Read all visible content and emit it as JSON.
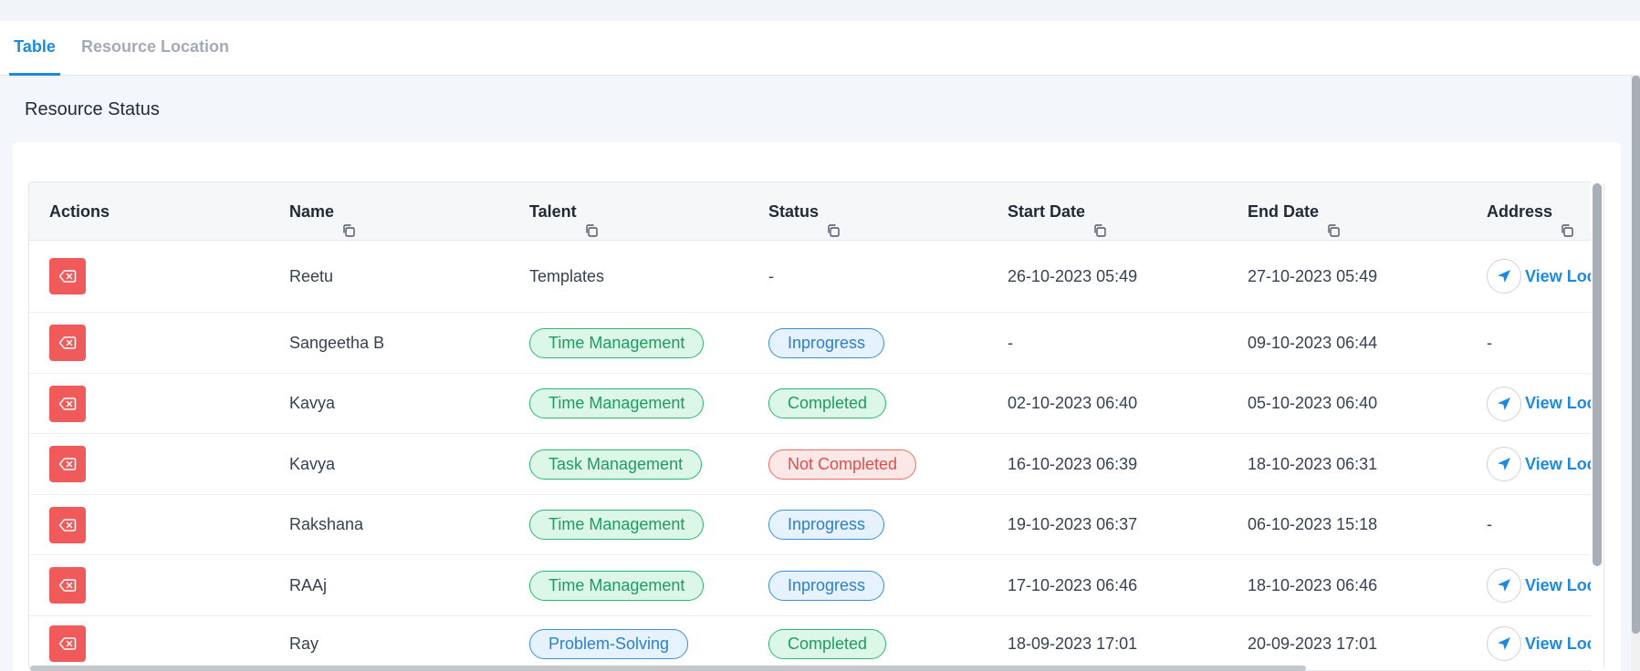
{
  "tabs": [
    {
      "label": "Table",
      "active": true
    },
    {
      "label": "Resource Location",
      "active": false
    }
  ],
  "page_title": "Resource Status",
  "table": {
    "columns": [
      "Actions",
      "Name",
      "Talent",
      "Status",
      "Start Date",
      "End Date",
      "Address"
    ],
    "view_location_label": "View Loc",
    "rows": [
      {
        "name": "Reetu",
        "talent": "Templates",
        "talent_type": "plain",
        "status": "-",
        "status_type": "plain",
        "start": "26-10-2023 05:49",
        "end": "27-10-2023 05:49",
        "address": "view"
      },
      {
        "name": "Sangeetha B",
        "talent": "Time Management",
        "talent_type": "green",
        "status": "Inprogress",
        "status_type": "blue",
        "start": "-",
        "end": "09-10-2023 06:44",
        "address": "-"
      },
      {
        "name": "Kavya",
        "talent": "Time Management",
        "talent_type": "green",
        "status": "Completed",
        "status_type": "green",
        "start": "02-10-2023 06:40",
        "end": "05-10-2023 06:40",
        "address": "view"
      },
      {
        "name": "Kavya",
        "talent": "Task Management",
        "talent_type": "green",
        "status": "Not Completed",
        "status_type": "red",
        "start": "16-10-2023 06:39",
        "end": "18-10-2023 06:31",
        "address": "view"
      },
      {
        "name": "Rakshana",
        "talent": "Time Management",
        "talent_type": "green",
        "status": "Inprogress",
        "status_type": "blue",
        "start": "19-10-2023 06:37",
        "end": "06-10-2023 15:18",
        "address": "-"
      },
      {
        "name": "RAAj",
        "talent": "Time Management",
        "talent_type": "green",
        "status": "Inprogress",
        "status_type": "blue",
        "start": "17-10-2023 06:46",
        "end": "18-10-2023 06:46",
        "address": "view"
      },
      {
        "name": "Ray",
        "talent": "Problem-Solving",
        "talent_type": "blue",
        "status": "Completed",
        "status_type": "green",
        "start": "18-09-2023 17:01",
        "end": "20-09-2023 17:01",
        "address": "view"
      }
    ]
  },
  "colors": {
    "accent": "#1d8ae0",
    "delete": "#f15a5a",
    "green_pill": "#2bb673",
    "blue_pill": "#3a8fd8",
    "red_pill": "#ef6b6b"
  },
  "icons": {
    "action": "backspace-delete-icon",
    "copy": "copy-icon",
    "address": "navigation-arrow-icon"
  }
}
